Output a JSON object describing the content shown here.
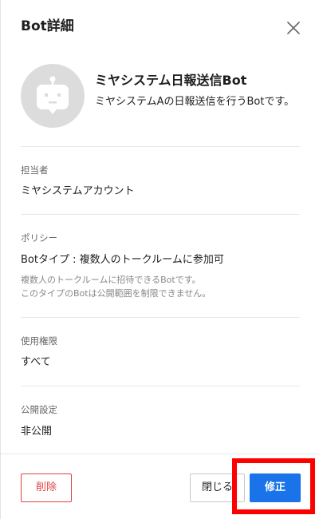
{
  "dialog": {
    "title": "Bot詳細"
  },
  "bot": {
    "name": "ミヤシステム日報送信Bot",
    "description": "ミヤシステムAの日報送信を行うBotです。",
    "avatar_icon": "robot-icon"
  },
  "sections": {
    "owner": {
      "label": "担当者",
      "value": "ミヤシステムアカウント"
    },
    "policy": {
      "label": "ポリシー",
      "value": "Botタイプ : 複数人のトークルームに参加可",
      "note_line1": "複数人のトークルームに招待できるBotです。",
      "note_line2": "このタイプのBotは公開範囲を制限できません。"
    },
    "permission": {
      "label": "使用権限",
      "value": "すべて"
    },
    "visibility": {
      "label": "公開設定",
      "value": "非公開"
    }
  },
  "footer": {
    "delete_label": "削除",
    "close_label": "閉じる",
    "edit_label": "修正"
  },
  "colors": {
    "primary": "#1a73e8",
    "danger": "#e24040",
    "highlight": "#ff0000",
    "avatar_bg": "#dcdcdc"
  }
}
